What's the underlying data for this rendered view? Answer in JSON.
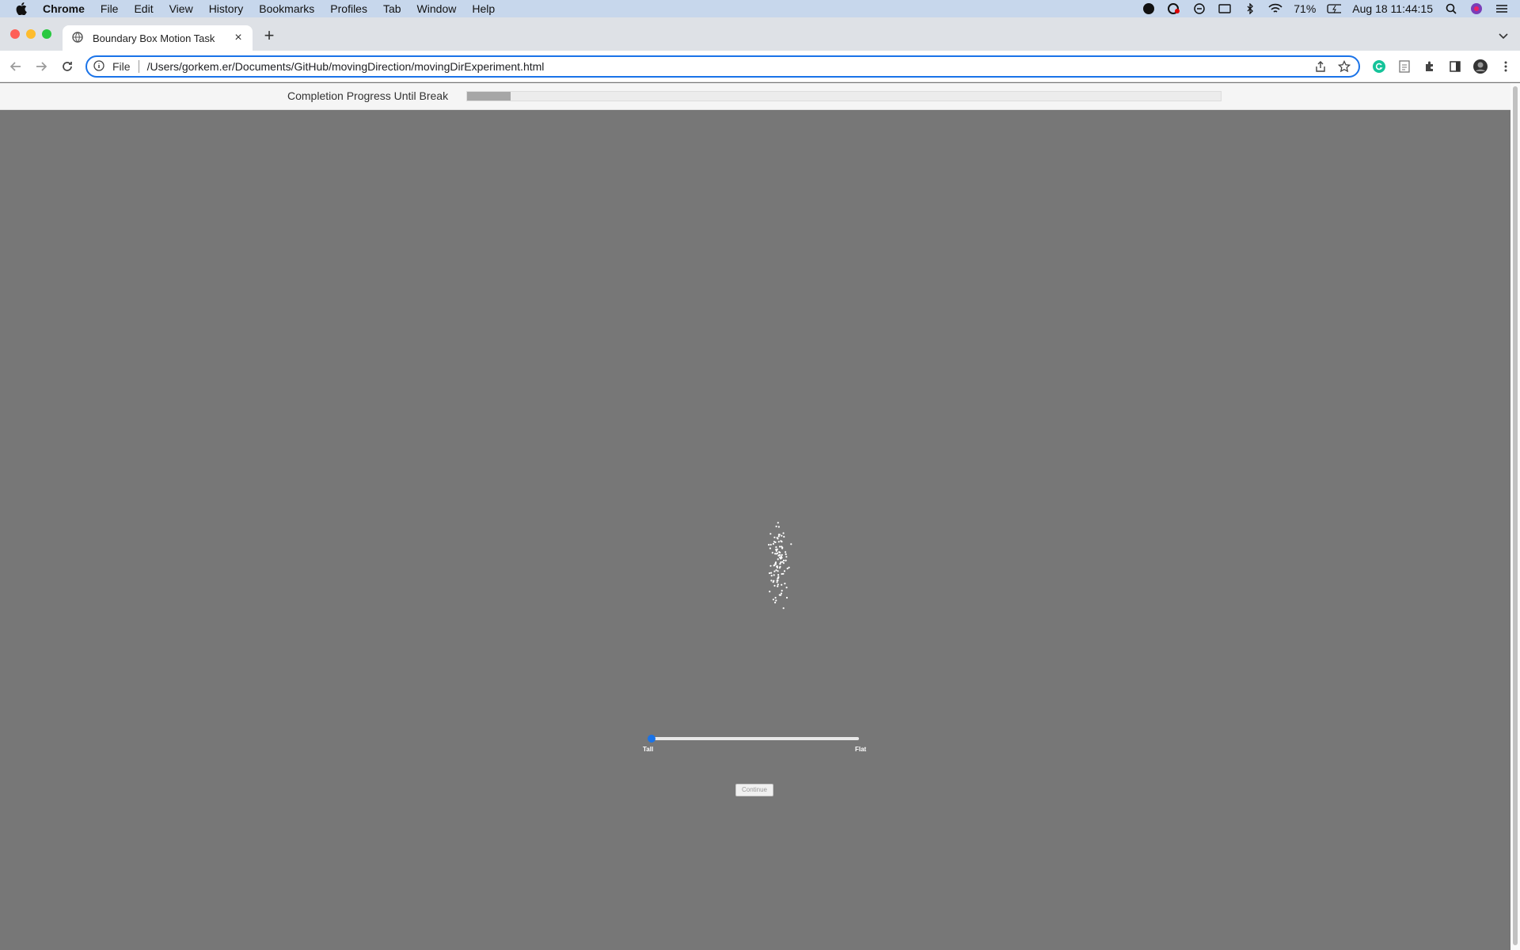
{
  "menubar": {
    "app": "Chrome",
    "items": [
      "File",
      "Edit",
      "View",
      "History",
      "Bookmarks",
      "Profiles",
      "Tab",
      "Window",
      "Help"
    ],
    "battery": "71%",
    "datetime": "Aug 18  11:44:15"
  },
  "browser": {
    "tab_title": "Boundary Box Motion Task",
    "scheme_label": "File",
    "url": "/Users/gorkem.er/Documents/GitHub/movingDirection/movingDirExperiment.html"
  },
  "page": {
    "progress_label": "Completion Progress Until Break",
    "progress_fraction": 0.058,
    "slider": {
      "min_label": "Tall",
      "max_label": "Flat",
      "value_fraction": 0.0
    },
    "continue_label": "Continue"
  },
  "colors": {
    "background": "#777777",
    "accent": "#1a73e8",
    "dots": "#ffffff"
  }
}
